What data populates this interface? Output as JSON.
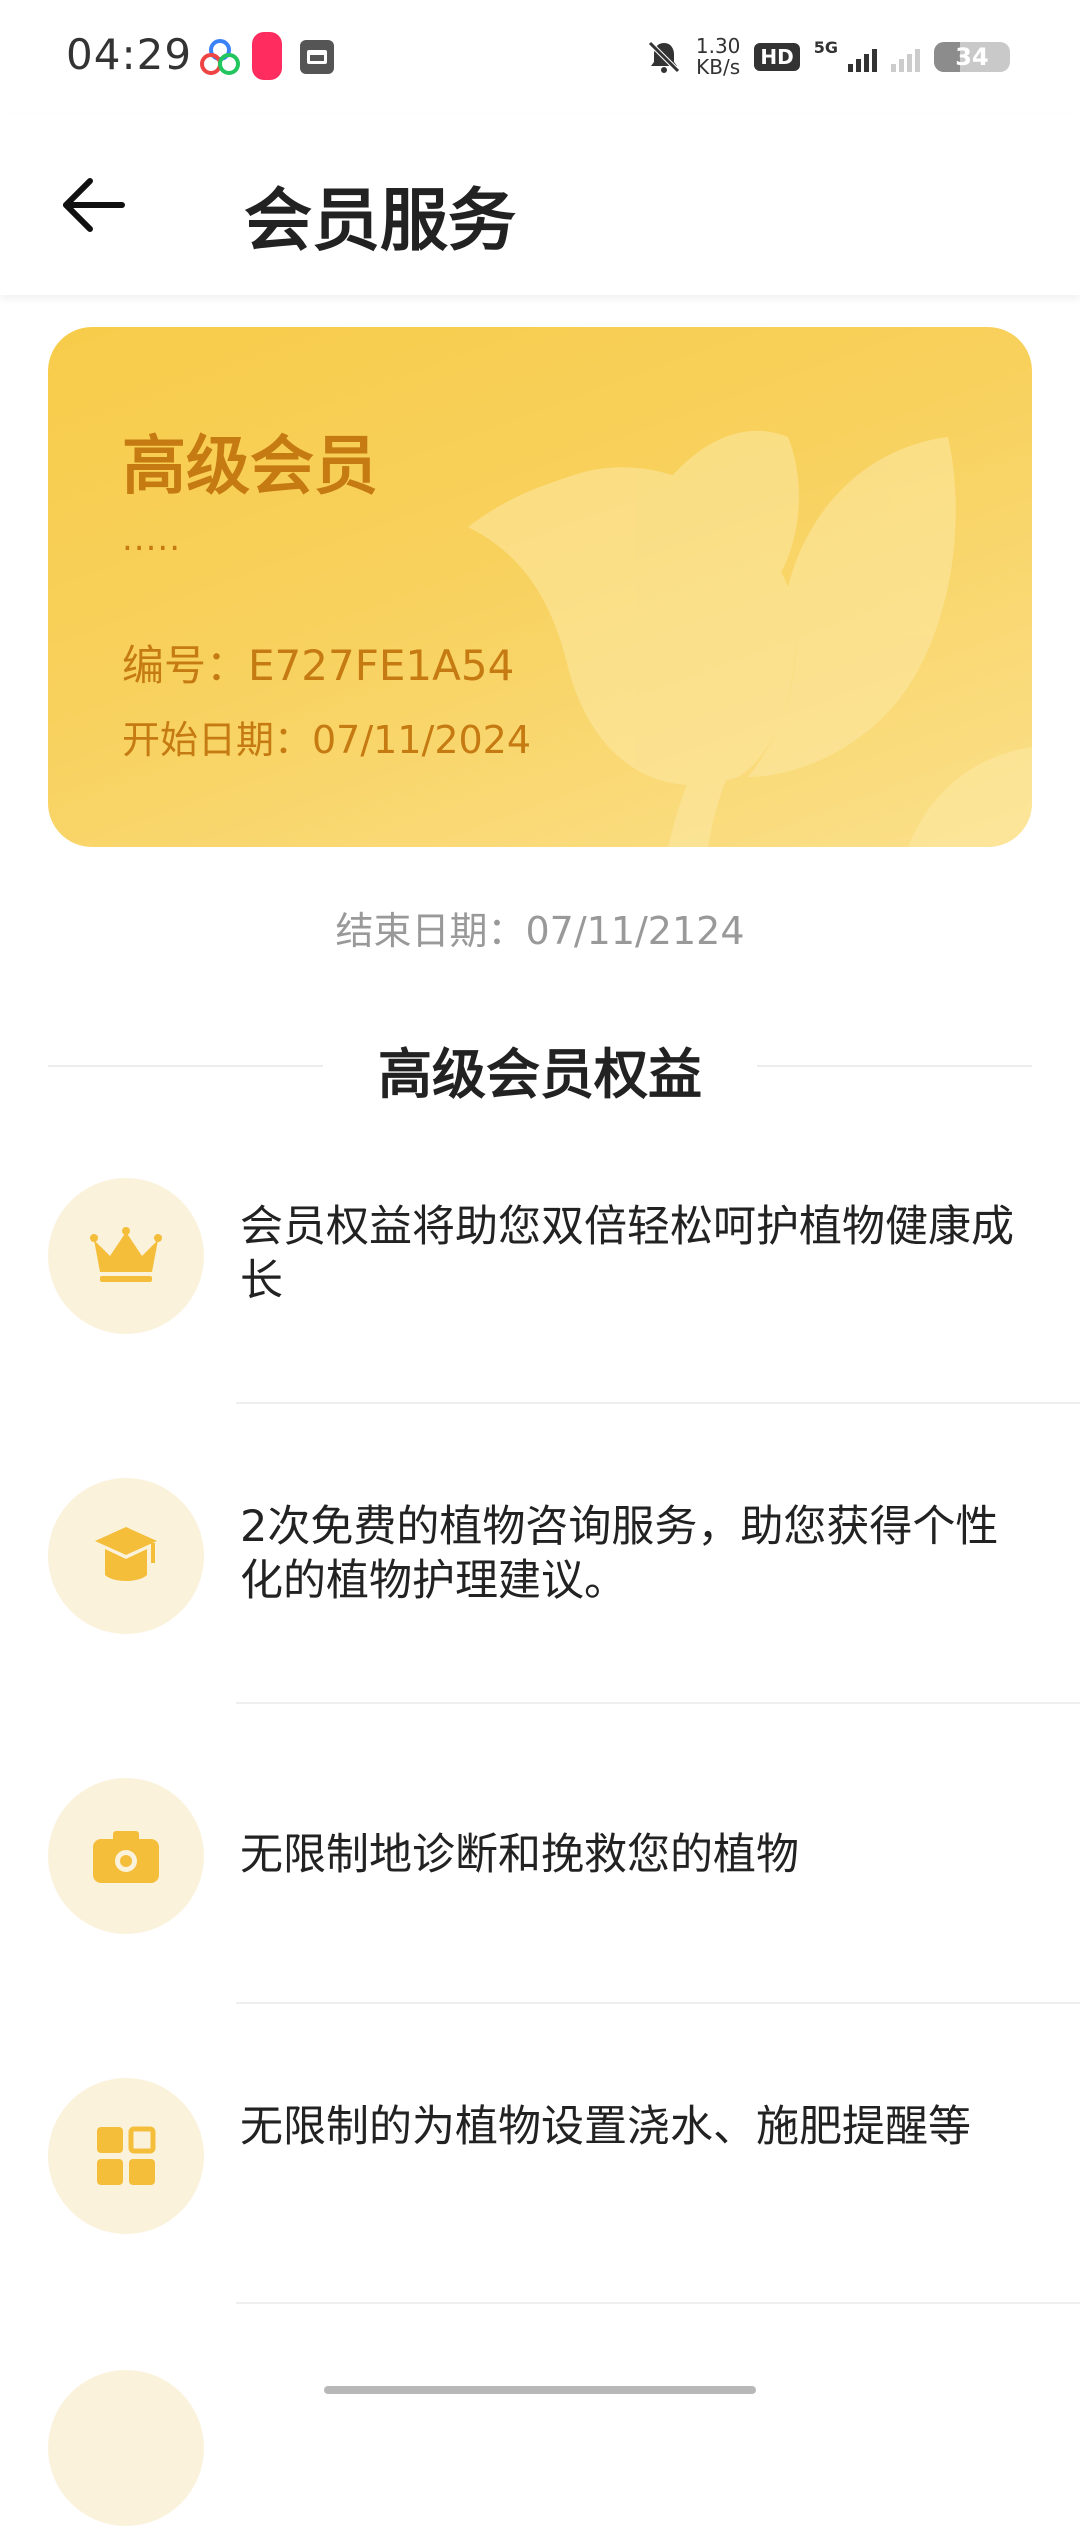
{
  "status_bar": {
    "time": "04:29",
    "speed_value": "1.30",
    "speed_unit": "KB/s",
    "hd_label": "HD",
    "network": "5G",
    "battery": "34"
  },
  "header": {
    "title": "会员服务"
  },
  "card": {
    "level": "高级会员",
    "dots": ".....",
    "id_text": "编号：E727FE1A54",
    "start_text": "开始日期：07/11/2024"
  },
  "end_date_text": "结束日期：07/11/2124",
  "benefits_section": {
    "title": "高级会员权益",
    "items": [
      {
        "icon": "crown-icon",
        "text": "会员权益将助您双倍轻松呵护植物健康成长"
      },
      {
        "icon": "graduation-cap-icon",
        "text": "2次免费的植物咨询服务，助您获得个性化的植物护理建议。"
      },
      {
        "icon": "camera-icon",
        "text": "无限制地诊断和挽救您的植物"
      },
      {
        "icon": "grid-icon",
        "text": "无限制的为植物设置浇水、施肥提醒等"
      }
    ]
  },
  "colors": {
    "card_gold": "#f8cc4a",
    "card_text": "#c57a12",
    "icon_gold": "#f4be3b",
    "icon_bg": "#fbf2dc"
  }
}
